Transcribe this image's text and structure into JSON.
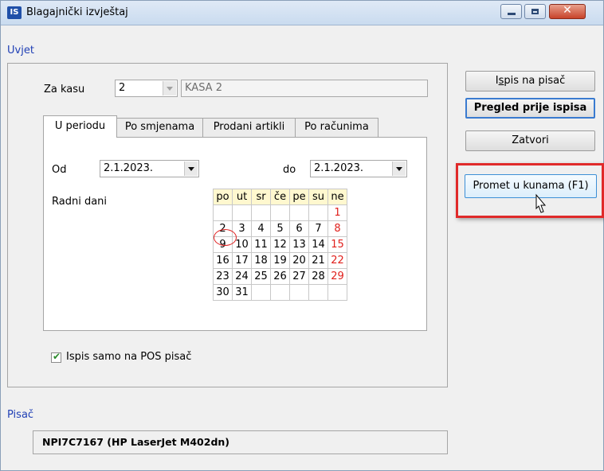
{
  "window": {
    "app_icon": "IS",
    "title": "Blagajnički izvještaj",
    "controls": [
      "minimize-icon",
      "maximize-icon",
      "close-icon"
    ]
  },
  "uvjet": {
    "label": "Uvjet",
    "za_kasu_label": "Za kasu",
    "kasa_value": "2",
    "kasa_name": "KASA 2"
  },
  "tabs": [
    "U periodu",
    "Po smjenama",
    "Prodani artikli",
    "Po računima"
  ],
  "period": {
    "od_label": "Od",
    "od_value": "2.1.2023.",
    "do_label": "do",
    "do_value": "2.1.2023.",
    "radni_dani_label": "Radni dani"
  },
  "calendar": {
    "headers": [
      "po",
      "ut",
      "sr",
      "če",
      "pe",
      "su",
      "ne"
    ],
    "rows": [
      [
        "",
        "",
        "",
        "",
        "",
        "",
        "1"
      ],
      [
        "2",
        "3",
        "4",
        "5",
        "6",
        "7",
        "8"
      ],
      [
        "9",
        "10",
        "11",
        "12",
        "13",
        "14",
        "15"
      ],
      [
        "16",
        "17",
        "18",
        "19",
        "20",
        "21",
        "22"
      ],
      [
        "23",
        "24",
        "25",
        "26",
        "27",
        "28",
        "29"
      ],
      [
        "30",
        "31",
        "",
        "",
        "",
        "",
        ""
      ]
    ],
    "selected_day": "2",
    "sunday_color": "#e0201c"
  },
  "pos_only": {
    "label": "Ispis samo na POS pisač",
    "checked": true
  },
  "pisac": {
    "label": "Pisač",
    "value": "NPI7C7167 (HP LaserJet M402dn)"
  },
  "buttons": {
    "ispis_pre": "I",
    "ispis_acc": "s",
    "ispis_post": "pis na pisač",
    "pregled_pre": "Pre",
    "pregled_acc": "g",
    "pregled_post": "led prije ispisa",
    "zatvori": "Zatvori",
    "promet": "Promet u kunama (F1)"
  },
  "colors": {
    "accent_label": "#1f3fb5",
    "highlight": "#e02a2a",
    "calendar_header": "#fff8cf"
  }
}
